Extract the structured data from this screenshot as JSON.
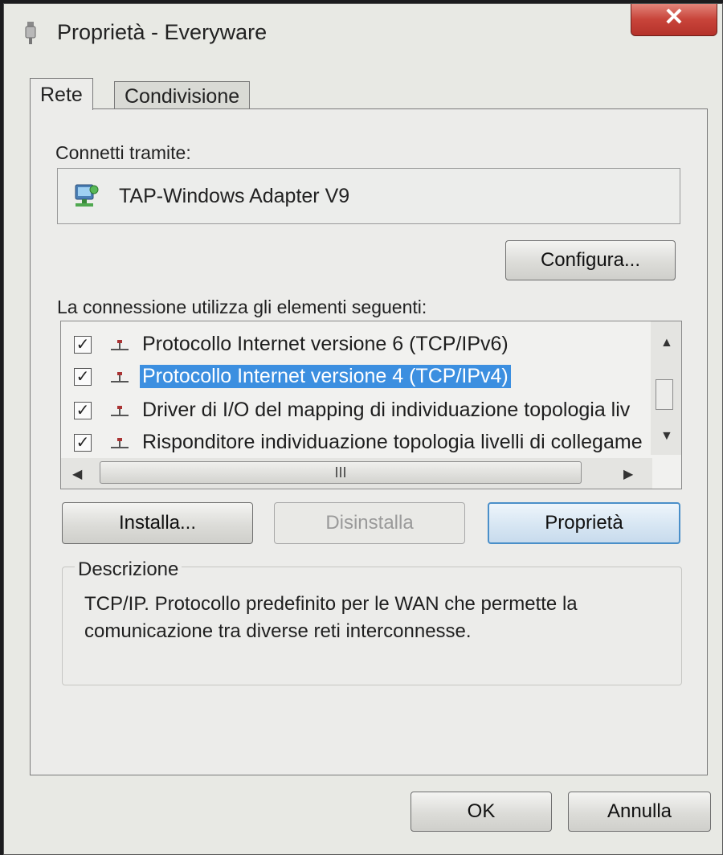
{
  "window": {
    "title": "Proprietà - Everyware",
    "close_glyph": "✕"
  },
  "tabs": [
    {
      "label": "Rete",
      "active": true
    },
    {
      "label": "Condivisione",
      "active": false
    }
  ],
  "connect": {
    "label": "Connetti tramite:",
    "adapter_name": "TAP-Windows Adapter V9",
    "adapter_icon": "network-adapter-icon",
    "configure_button": "Configura..."
  },
  "components": {
    "label": "La connessione utilizza gli elementi seguenti:",
    "items": [
      {
        "checked": "✓",
        "icon": "protocol-icon",
        "text": "Protocollo Internet versione 6 (TCP/IPv6)"
      },
      {
        "checked": "✓",
        "icon": "protocol-icon",
        "text": "Protocollo Internet versione 4 (TCP/IPv4)",
        "selected": true
      },
      {
        "checked": "✓",
        "icon": "protocol-icon",
        "text": "Driver di I/O del mapping di individuazione topologia liv"
      },
      {
        "checked": "✓",
        "icon": "protocol-icon",
        "text": "Risponditore individuazione topologia livelli di collegame"
      }
    ],
    "scroll_up": "▲",
    "scroll_down": "▼",
    "scroll_left": "◀",
    "scroll_right": "▶",
    "hthumb_grip": "III"
  },
  "actions": {
    "install": "Installa...",
    "uninstall": "Disinstalla",
    "properties": "Proprietà"
  },
  "description": {
    "title": "Descrizione",
    "text": "TCP/IP. Protocollo predefinito per le WAN che permette la comunicazione tra diverse reti interconnesse."
  },
  "footer": {
    "ok": "OK",
    "cancel": "Annulla"
  },
  "colors": {
    "selection": "#3c8fe0",
    "close_button": "#c8443a",
    "dialog_bg": "#ececea"
  }
}
